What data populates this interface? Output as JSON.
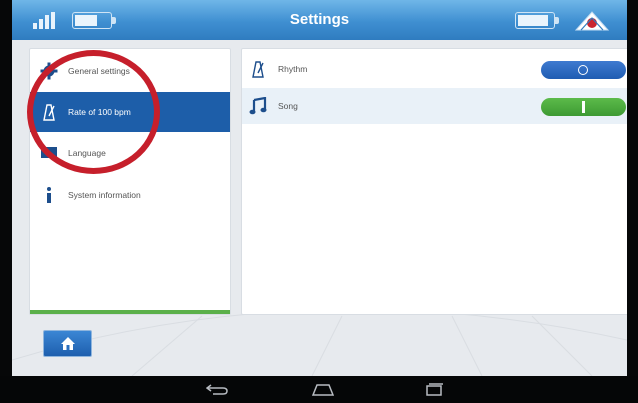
{
  "header": {
    "title": "Settings"
  },
  "sidebar": {
    "items": [
      {
        "label": "General settings",
        "icon": "gear-icon"
      },
      {
        "label": "Rate of 100 bpm",
        "icon": "metronome-icon"
      },
      {
        "label": "Language",
        "icon": "flag-icon"
      },
      {
        "label": "System information",
        "icon": "info-icon"
      }
    ]
  },
  "main": {
    "options": [
      {
        "label": "Rhythm",
        "icon": "metronome-icon",
        "toggle": "off"
      },
      {
        "label": "Song",
        "icon": "music-note-icon",
        "toggle": "on"
      }
    ]
  },
  "colors": {
    "header": "#3f8fd1",
    "active_item": "#1d5ea9",
    "toggle_off": "#1f5cb2",
    "toggle_on": "#3d9a33",
    "annotation": "#c61f2b"
  }
}
